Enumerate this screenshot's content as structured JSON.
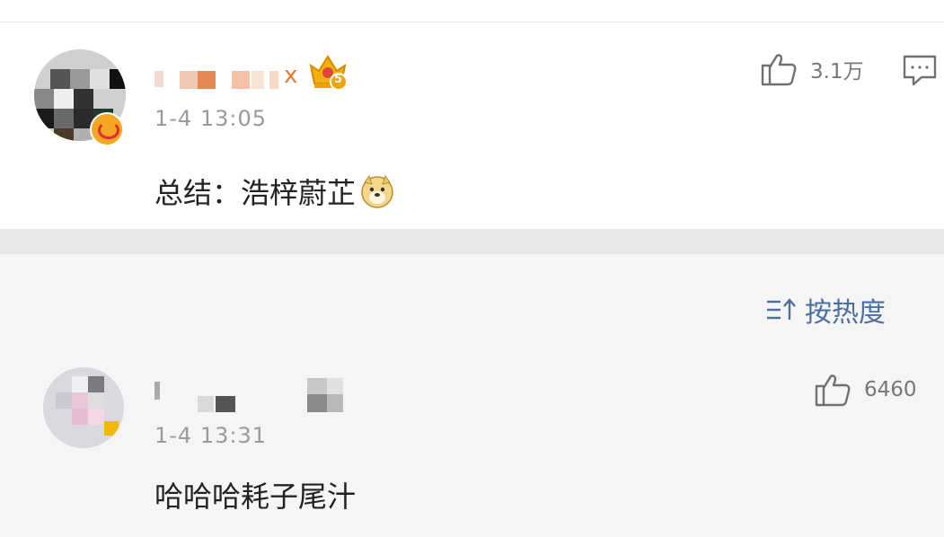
{
  "post": {
    "name_suffix": "x",
    "vip_badge_number": "5",
    "time": "1-4 13:05",
    "content_text": "总结：浩梓蔚芷",
    "emoji": "doge-emoji",
    "like_count": "3.1万",
    "icons": {
      "like": "thumbs-up-icon",
      "comment": "comment-icon",
      "vip": "crown-badge-icon"
    }
  },
  "sort": {
    "label": "按热度",
    "icon": "sort-icon"
  },
  "comment": {
    "time": "1-4 13:31",
    "content_text": "哈哈哈耗子尾汁",
    "like_count": "6460",
    "icons": {
      "like": "thumbs-up-icon"
    }
  },
  "colors": {
    "link": "#4a6fa1",
    "badge": "#f0b323",
    "muted": "#9a9a9a"
  }
}
